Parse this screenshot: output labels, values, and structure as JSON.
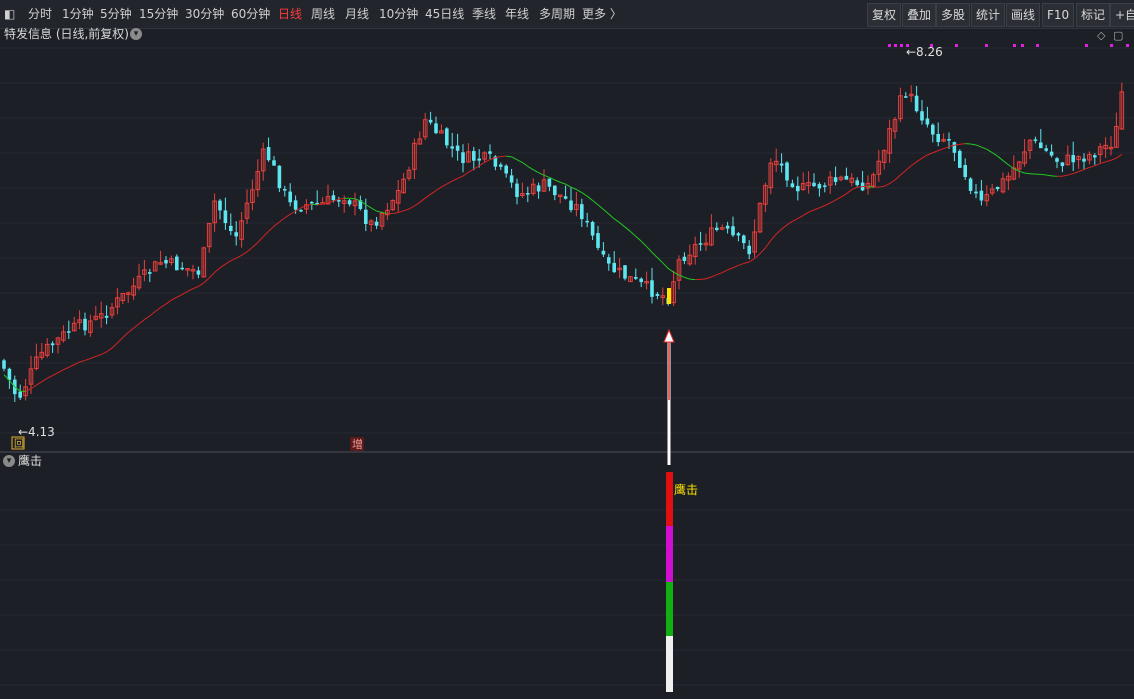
{
  "toolbar": {
    "periods": [
      {
        "label": "分时",
        "active": false
      },
      {
        "label": "1分钟",
        "active": false
      },
      {
        "label": "5分钟",
        "active": false
      },
      {
        "label": "15分钟",
        "active": false
      },
      {
        "label": "30分钟",
        "active": false
      },
      {
        "label": "60分钟",
        "active": false
      },
      {
        "label": "日线",
        "active": true
      },
      {
        "label": "周线",
        "active": false
      },
      {
        "label": "月线",
        "active": false
      },
      {
        "label": "10分钟",
        "active": false
      },
      {
        "label": "45日线",
        "active": false
      },
      {
        "label": "季线",
        "active": false
      },
      {
        "label": "年线",
        "active": false
      },
      {
        "label": "多周期",
        "active": false
      },
      {
        "label": "更多 〉",
        "active": false
      }
    ],
    "tools": [
      "复权",
      "叠加",
      "多股",
      "统计",
      "画线",
      "F10",
      "标记",
      "+自"
    ]
  },
  "chart": {
    "title": "特发信息 (日线,前复权)",
    "high_label": "8.26",
    "low_label": "4.13",
    "marker_hui": "回",
    "marker_zeng": "增",
    "colors": {
      "up": "#e8403c",
      "down": "#5de6f0",
      "ma_red": "#d42424",
      "ma_green": "#22c922",
      "bg": "#1c1f26",
      "signal": "#ffe400"
    }
  },
  "indicator": {
    "label": "鹰击",
    "signal_text": "鹰击",
    "bar_colors": [
      "#e01010",
      "#d010d0",
      "#10b010",
      "#f0f0f0"
    ]
  }
}
